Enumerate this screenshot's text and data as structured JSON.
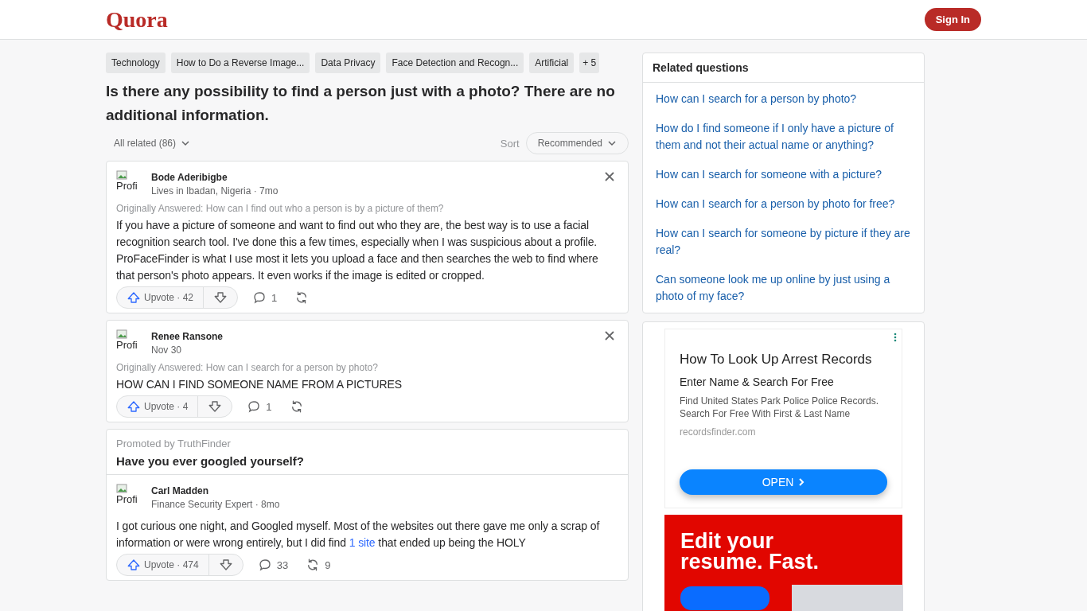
{
  "header": {
    "logo": "Quora",
    "sign_in": "Sign In"
  },
  "topics": [
    {
      "label": "Technology",
      "kind": "topic"
    },
    {
      "label": "How to Do a Reverse Image...",
      "kind": "topic"
    },
    {
      "label": "Data Privacy",
      "kind": "topic"
    },
    {
      "label": "Face Detection and Recogn...",
      "kind": "topic"
    },
    {
      "label": "Artificial",
      "kind": "topic"
    },
    {
      "label": "+ 5",
      "kind": "more"
    }
  ],
  "question": {
    "title": "Is there any possibility to find a person just with a photo? There are no additional information."
  },
  "filters": {
    "all_related": "All related (86)",
    "sort_label": "Sort",
    "sort_value": "Recommended"
  },
  "answers": [
    {
      "kind": "answer",
      "avatar_alt": "Profi",
      "author": "Bode Aderibigbe",
      "meta": "Lives in Ibadan, Nigeria · 7mo",
      "origin": "Originally Answered: How can I find out who a person is by a picture of them?",
      "body": [
        {
          "text": "If you have a picture of someone and want to find out who they are, the best way is to use a facial recognition search tool. I've done this a few times, especially when I was suspicious about a profile. ProFaceFinder is what I use most it lets you upload a face and then searches the web to find where that person's photo appears. It even works if the image is edited or cropped.",
          "kind": "text"
        }
      ],
      "upvote": "Upvote · 42",
      "comments": "1"
    },
    {
      "kind": "answer",
      "avatar_alt": "Profi",
      "author": "Renee Ransone",
      "meta": "Nov 30",
      "origin": "Originally Answered: How can I search for a person by photo?",
      "body": [
        {
          "text": "HOW CAN I FIND SOMEONE NAME FROM A PICTURES",
          "kind": "text"
        }
      ],
      "upvote": "Upvote · 4",
      "comments": "1"
    },
    {
      "kind": "promoted",
      "promoted_by": "Promoted by TruthFinder",
      "headline": "Have you ever googled yourself?",
      "avatar_alt": "Profi",
      "author": "Carl Madden",
      "meta": "Finance Security Expert · 8mo",
      "body": [
        {
          "text": "I got curious one night, and Googled myself. Most of the websites out there gave me only a scrap of information or were wrong entirely, but I did find ",
          "kind": "text"
        },
        {
          "text": "1 site",
          "kind": "link"
        },
        {
          "text": " that ended up being the HOLY",
          "kind": "text"
        }
      ],
      "upvote": "Upvote · 474",
      "comments": "33",
      "shares": "9"
    }
  ],
  "related": {
    "title": "Related questions",
    "items": [
      "How can I search for a person by photo?",
      "How do I find someone if I only have a picture of them and not their actual name or anything?",
      "How can I search for someone with a picture?",
      "How can I search for a person by photo for free?",
      "How can I search for someone by picture if they are real?",
      "Can someone look me up online by just using a photo of my face?"
    ]
  },
  "ad": {
    "title": "How To Look Up Arrest Records",
    "subtitle": "Enter Name & Search For Free",
    "description": "Find United States Park Police Police Records. Search For Free With First & Last Name",
    "domain": "recordsfinder.com",
    "button": "OPEN"
  },
  "banner": {
    "headline": [
      "Edit your",
      "resume. Fast."
    ]
  }
}
